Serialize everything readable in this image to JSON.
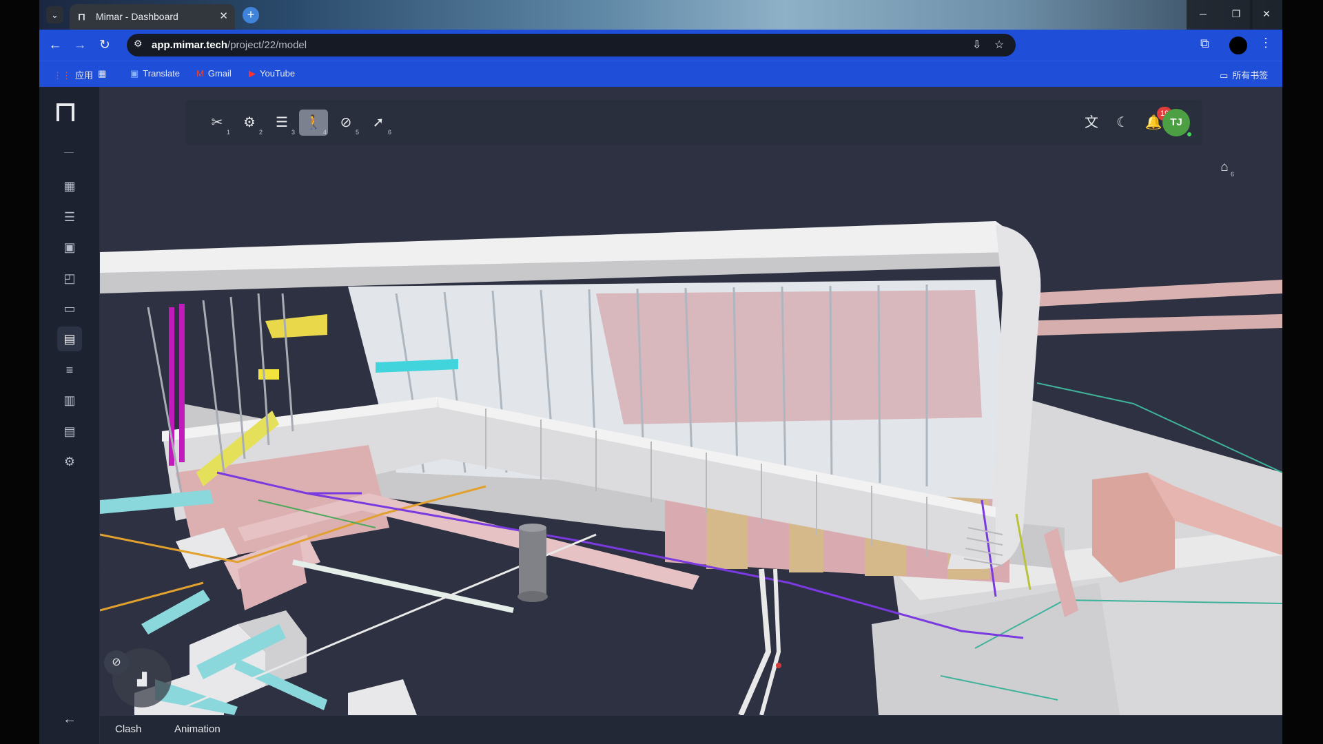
{
  "browser": {
    "tab": {
      "title": "Mimar - Dashboard",
      "favicon": "mimar-logo-icon",
      "close": "✕"
    },
    "new_tab": "+",
    "window_controls": {
      "minimize": "─",
      "restore": "❐",
      "close": "✕"
    },
    "url": {
      "host": "app.mimar.tech",
      "path": "/project/22/model"
    },
    "bookmarks": [
      {
        "label": "应用",
        "icon": "apps-grid-icon"
      },
      {
        "label": "",
        "icon": "grid-icon"
      },
      {
        "label": "Translate",
        "icon": "translate-icon"
      },
      {
        "label": "Gmail",
        "icon": "gmail-icon"
      },
      {
        "label": "YouTube",
        "icon": "youtube-icon"
      }
    ],
    "all_bookmarks": "所有书签"
  },
  "sidebar": {
    "items": [
      {
        "name": "dashboard",
        "icon": "grid-icon"
      },
      {
        "name": "tasks",
        "icon": "checklist-icon"
      },
      {
        "name": "calendar",
        "icon": "calendar-icon"
      },
      {
        "name": "presentation",
        "icon": "presentation-icon"
      },
      {
        "name": "folder",
        "icon": "folder-icon"
      },
      {
        "name": "model",
        "icon": "model-file-icon",
        "active": true
      },
      {
        "name": "list",
        "icon": "list-icon"
      },
      {
        "name": "kanban",
        "icon": "board-icon"
      },
      {
        "name": "document",
        "icon": "document-icon"
      },
      {
        "name": "settings",
        "icon": "gear-icon"
      }
    ],
    "back_icon": "arrow-left-icon"
  },
  "viewer_toolbar": {
    "tools": [
      {
        "name": "section",
        "icon": "scissors-icon",
        "shortcut": "1"
      },
      {
        "name": "settings",
        "icon": "settings-gear-icon",
        "shortcut": "2"
      },
      {
        "name": "levels",
        "icon": "layers-icon",
        "shortcut": "3"
      },
      {
        "name": "walk",
        "icon": "walk-icon",
        "shortcut": "4",
        "active": true
      },
      {
        "name": "orbit",
        "icon": "orbit-icon",
        "shortcut": "5"
      },
      {
        "name": "select",
        "icon": "cursor-icon",
        "shortcut": "6"
      }
    ],
    "home_shortcut": "6",
    "notifications_count": "19",
    "user_initials": "TJ"
  },
  "bottom_tabs": [
    "Clash",
    "Animation"
  ],
  "colors": {
    "brand_blue": "#1f4fd8",
    "viewport_bg": "#2d3141",
    "sidebar_bg": "#1d2230",
    "badge_red": "#e03d3d",
    "avatar_green": "#4c9f43"
  }
}
